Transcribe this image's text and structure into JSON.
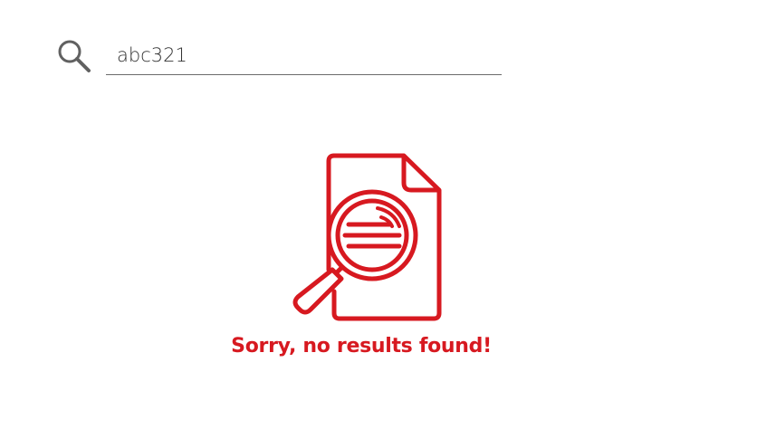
{
  "search": {
    "value": "abc321",
    "icon": "search-icon"
  },
  "empty_state": {
    "icon": "document-search-icon",
    "message": "Sorry, no results found!",
    "color": "#d71920"
  },
  "colors": {
    "accent": "#d71920",
    "underline": "#6b6b6b",
    "icon_gray": "#616161"
  }
}
